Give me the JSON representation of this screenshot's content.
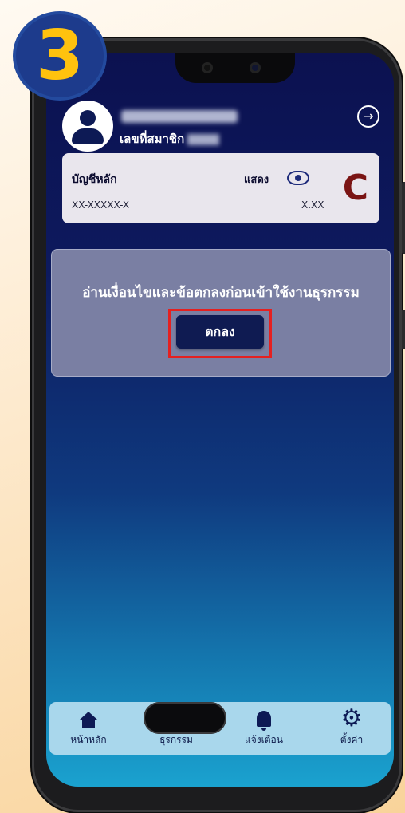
{
  "step_badge": "3",
  "header": {
    "member_label": "เลขที่สมาชิก"
  },
  "account": {
    "title": "บัญชีหลัก",
    "number": "XX-XXXXX-X",
    "show_label": "แสดง",
    "balance": "X.XX"
  },
  "dialog": {
    "message": "อ่านเงื่อนไขและข้อตกลงก่อนเข้าใช้งานธุรกรรม",
    "ok_label": "ตกลง"
  },
  "nav": {
    "items": [
      {
        "label": "หน้าหลัก",
        "icon": "home-icon"
      },
      {
        "label": "ธุรกรรม",
        "icon": "money-icon"
      },
      {
        "label": "แจ้งเตือน",
        "icon": "bell-icon"
      },
      {
        "label": "ตั้งค่า",
        "icon": "gear-icon"
      }
    ]
  },
  "colors": {
    "badge_bg": "#1d3b8c",
    "badge_fg": "#ffc20e",
    "highlight": "#e52020",
    "ok_button": "#0f1b52",
    "refresh": "#7a1414"
  }
}
